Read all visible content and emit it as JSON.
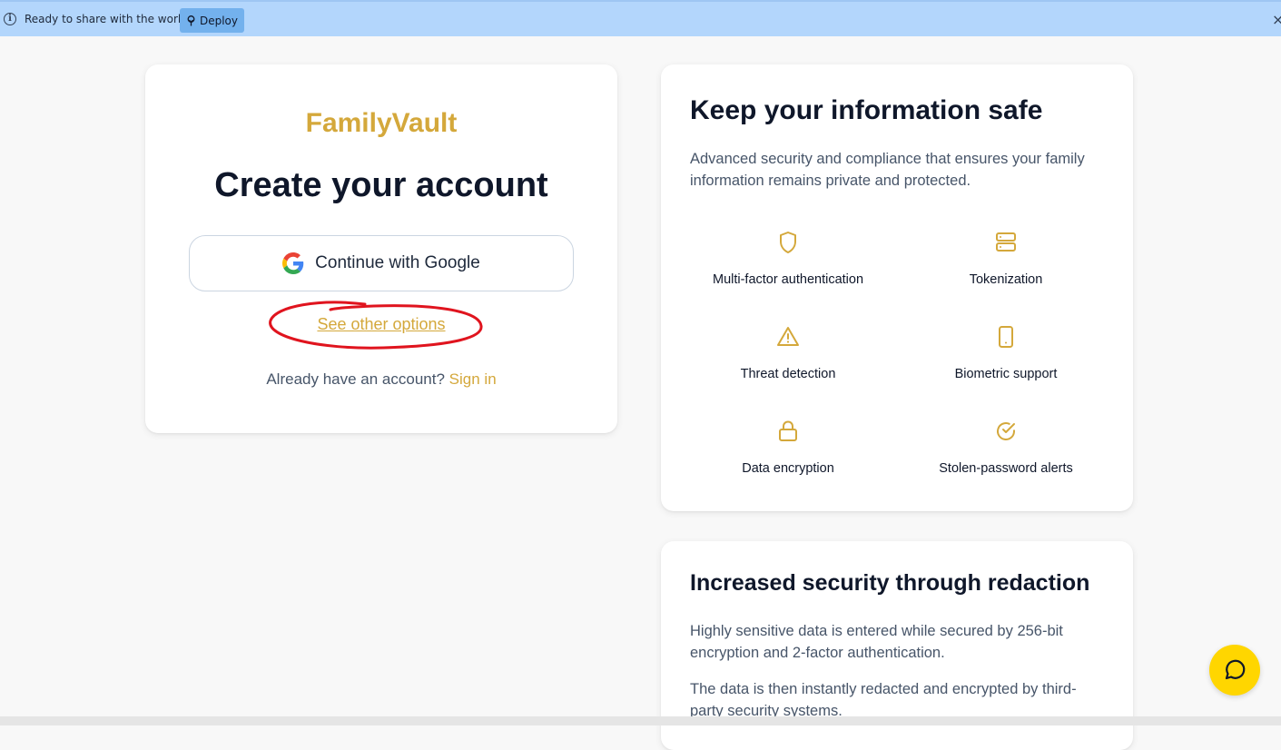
{
  "banner": {
    "text": "Ready to share with the world?",
    "deploy_label": "Deploy",
    "close_glyph": "×",
    "info_glyph": "i",
    "color": "#b3d6fc"
  },
  "signup": {
    "brand": "FamilyVault",
    "title": "Create your account",
    "google_label": "Continue with Google",
    "other_options": "See other options",
    "already_text": "Already have an account?",
    "signin_label": "Sign in"
  },
  "safe_card": {
    "title": "Keep your information safe",
    "description": "Advanced security and compliance that ensures your family information remains private and protected.",
    "features": [
      {
        "icon": "shield-icon",
        "label": "Multi-factor authentication"
      },
      {
        "icon": "server-icon",
        "label": "Tokenization"
      },
      {
        "icon": "alert-triangle-icon",
        "label": "Threat detection"
      },
      {
        "icon": "smartphone-icon",
        "label": "Biometric support"
      },
      {
        "icon": "lock-icon",
        "label": "Data encryption"
      },
      {
        "icon": "check-circle-icon",
        "label": "Stolen-password alerts"
      }
    ]
  },
  "redaction_card": {
    "title": "Increased security through redaction",
    "paragraph1": "Highly sensitive data is entered while secured by 256-bit encryption and 2-factor authentication.",
    "paragraph2": "The data is then instantly redacted and encrypted by third-party security systems."
  },
  "colors": {
    "accent": "#d4a83b",
    "chat_button": "#ffd600",
    "annotation": "#e0141e"
  }
}
